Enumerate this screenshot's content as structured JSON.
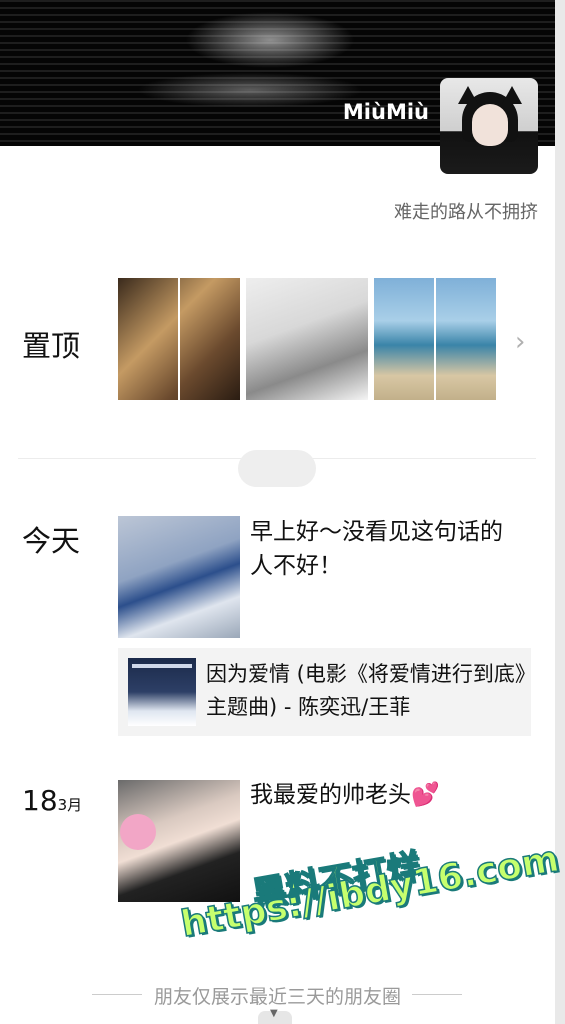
{
  "profile": {
    "nickname": "MiùMiù",
    "signature": "难走的路从不拥挤"
  },
  "pinned": {
    "label": "置顶",
    "more_icon": "chevron-right-icon"
  },
  "today": {
    "label": "今天",
    "post_text": "早上好～没看见这句话的人不好！",
    "music_title": "因为爱情 (电影《将爱情进行到底》主题曲) - 陈奕迅/王菲"
  },
  "march": {
    "day": "18",
    "month": "3月",
    "post_text": "我最爱的帅老头",
    "emoji": "💕"
  },
  "watermark": {
    "line1": "黑料不打烊",
    "line2": "https://ibdy16.com"
  },
  "footer": {
    "text": "朋友仅展示最近三天的朋友圈"
  }
}
